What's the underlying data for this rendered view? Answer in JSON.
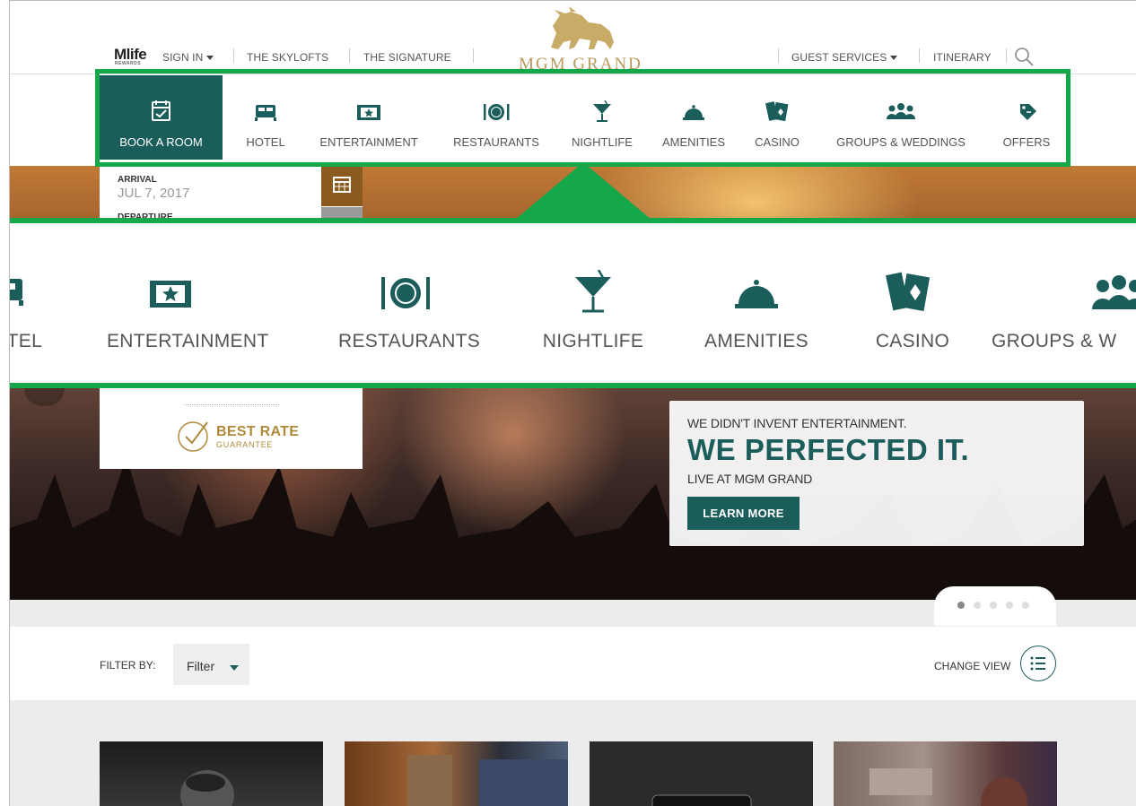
{
  "topbar": {
    "mlife_brand": "Mlife",
    "mlife_sub": "REWARDS",
    "sign_in": "SIGN IN",
    "skylofts": "THE SKYLOFTS",
    "signature": "THE SIGNATURE",
    "logo_text": "MGM GRAND",
    "guest_services": "GUEST SERVICES",
    "itinerary": "ITINERARY"
  },
  "nav": {
    "items": [
      {
        "label": "BOOK A ROOM",
        "icon": "calendar-check-icon",
        "active": true
      },
      {
        "label": "HOTEL",
        "icon": "bed-icon"
      },
      {
        "label": "ENTERTAINMENT",
        "icon": "ticket-star-icon"
      },
      {
        "label": "RESTAURANTS",
        "icon": "plate-cutlery-icon"
      },
      {
        "label": "NIGHTLIFE",
        "icon": "cocktail-icon"
      },
      {
        "label": "AMENITIES",
        "icon": "service-bell-icon"
      },
      {
        "label": "CASINO",
        "icon": "playing-cards-icon"
      },
      {
        "label": "GROUPS & WEDDINGS",
        "icon": "people-group-icon"
      },
      {
        "label": "OFFERS",
        "icon": "price-tag-icon"
      }
    ]
  },
  "zoom": {
    "items": [
      {
        "label": "HOTEL",
        "visible_text": "OTEL"
      },
      {
        "label": "ENTERTAINMENT"
      },
      {
        "label": "RESTAURANTS"
      },
      {
        "label": "NIGHTLIFE"
      },
      {
        "label": "AMENITIES"
      },
      {
        "label": "CASINO"
      },
      {
        "label": "GROUPS & WEDDINGS",
        "visible_text": "GROUPS & W"
      }
    ]
  },
  "booking": {
    "arrival_label": "ARRIVAL",
    "arrival_value": "JUL 7, 2017",
    "departure_label": "DEPARTURE"
  },
  "best_rate": {
    "title": "BEST RATE",
    "subtitle": "GUARANTEE"
  },
  "promo": {
    "line1": "WE DIDN'T INVENT ENTERTAINMENT.",
    "headline": "WE PERFECTED IT.",
    "line3": "LIVE AT MGM GRAND",
    "button": "LEARN MORE"
  },
  "carousel": {
    "slides": 5,
    "current": 1
  },
  "filter": {
    "label": "FILTER BY:",
    "value": "Filter",
    "change_view": "CHANGE VIEW"
  },
  "colors": {
    "brand_teal": "#1b5d5b",
    "highlight_green": "#15a84a",
    "gold": "#b79a5a"
  }
}
